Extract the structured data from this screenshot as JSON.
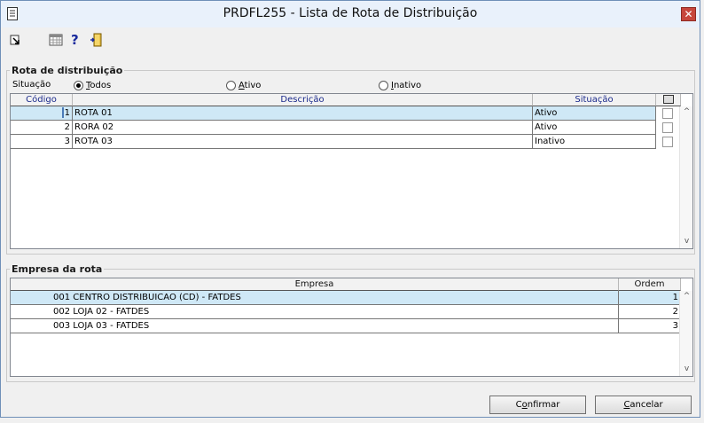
{
  "window": {
    "title": "PRDFL255 - Lista de Rota de Distribuição"
  },
  "toolbar": {
    "icons": [
      "exit-arrow-icon",
      "calendar-grid-icon",
      "help-icon",
      "door-exit-icon"
    ],
    "help_glyph": "?"
  },
  "rota": {
    "group_title": "Rota de distribuição",
    "situacao_label": "Situação",
    "filter_options": [
      {
        "label": "Todos",
        "accel": "T",
        "rest": "odos",
        "checked": true
      },
      {
        "label": "Ativo",
        "accel": "A",
        "rest": "tivo",
        "checked": false
      },
      {
        "label": "Inativo",
        "accel": "I",
        "rest": "nativo",
        "checked": false
      }
    ],
    "columns": [
      "Código",
      "Descrição",
      "Situação"
    ],
    "rows": [
      {
        "codigo": "1",
        "descricao": "ROTA 01",
        "situacao": "Ativo",
        "selected": true
      },
      {
        "codigo": "2",
        "descricao": "RORA 02",
        "situacao": "Ativo",
        "selected": false
      },
      {
        "codigo": "3",
        "descricao": "ROTA 03",
        "situacao": "Inativo",
        "selected": false
      }
    ]
  },
  "empresa": {
    "group_title": "Empresa da rota",
    "columns": [
      "Empresa",
      "Ordem"
    ],
    "rows": [
      {
        "codigo": "001",
        "nome": "CENTRO DISTRIBUICAO (CD) - FATDES",
        "ordem": "1",
        "selected": true
      },
      {
        "codigo": "002",
        "nome": "LOJA 02 - FATDES",
        "ordem": "2",
        "selected": false
      },
      {
        "codigo": "003",
        "nome": "LOJA 03 - FATDES",
        "ordem": "3",
        "selected": false
      }
    ]
  },
  "buttons": {
    "confirmar": {
      "label": "Confirmar",
      "accel": "o",
      "pre": "C",
      "post": "nfirmar"
    },
    "cancelar": {
      "label": "Cancelar",
      "accel": "C",
      "pre": "",
      "post": "ancelar"
    }
  },
  "colors": {
    "selection": "#cfe8f6",
    "header_text": "#1b2a8c",
    "close_button": "#c7463b"
  }
}
